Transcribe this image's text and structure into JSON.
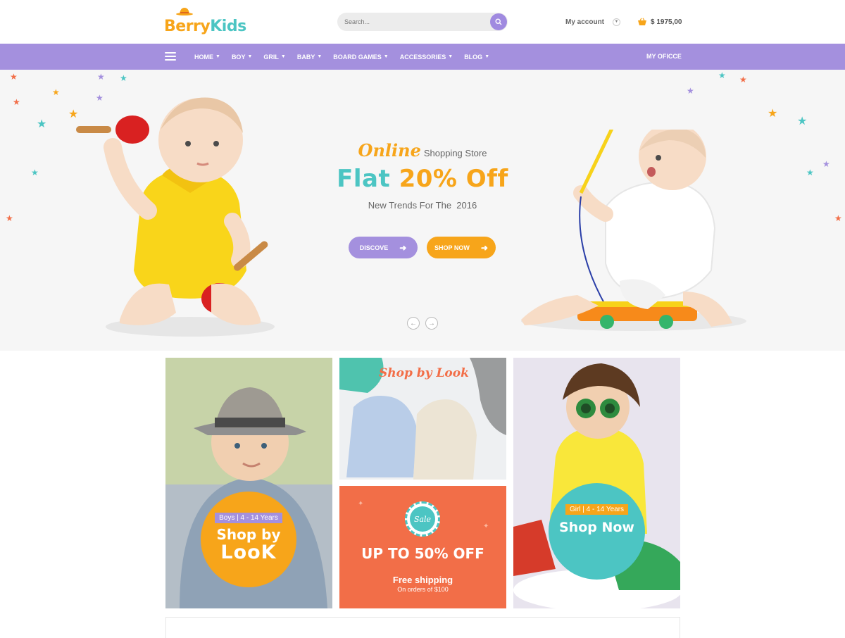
{
  "header": {
    "logo_part1": "Berry",
    "logo_part2": "Kids",
    "search_placeholder": "Search...",
    "account_label": "My account",
    "cart_total": "$ 1975,00"
  },
  "nav": {
    "items": [
      {
        "label": "HOME"
      },
      {
        "label": "BOY"
      },
      {
        "label": "GRIL"
      },
      {
        "label": "BABY"
      },
      {
        "label": "BOARD GAMES"
      },
      {
        "label": "ACCESSORIES"
      },
      {
        "label": "BLOG"
      }
    ],
    "right_label": "MY OFICCE"
  },
  "hero": {
    "online": "Online",
    "store": "Shopping Store",
    "title_part1": "Flat",
    "title_part2": "20% Off",
    "subtitle": "New Trends For The  2016",
    "btn_discove": "DISCOVE",
    "btn_shop": "SHOP NOW"
  },
  "banners": {
    "boys_tag": "Boys | 4 - 14 Years",
    "boys_line1": "Shop by",
    "boys_line2": "LooK",
    "look_script": "Shop by Look",
    "sale_badge": "Sale",
    "sale_title": "UP TO 50% OFF",
    "sale_shipping": "Free shipping",
    "sale_orders": "On orders of $100",
    "girl_tag": "Girl | 4 - 14 Years",
    "girl_title": "Shop Now"
  },
  "colors": {
    "accent_purple": "#a490de",
    "accent_orange": "#f7a51a",
    "accent_teal": "#4cc5c3",
    "sale_red": "#f26e48"
  }
}
